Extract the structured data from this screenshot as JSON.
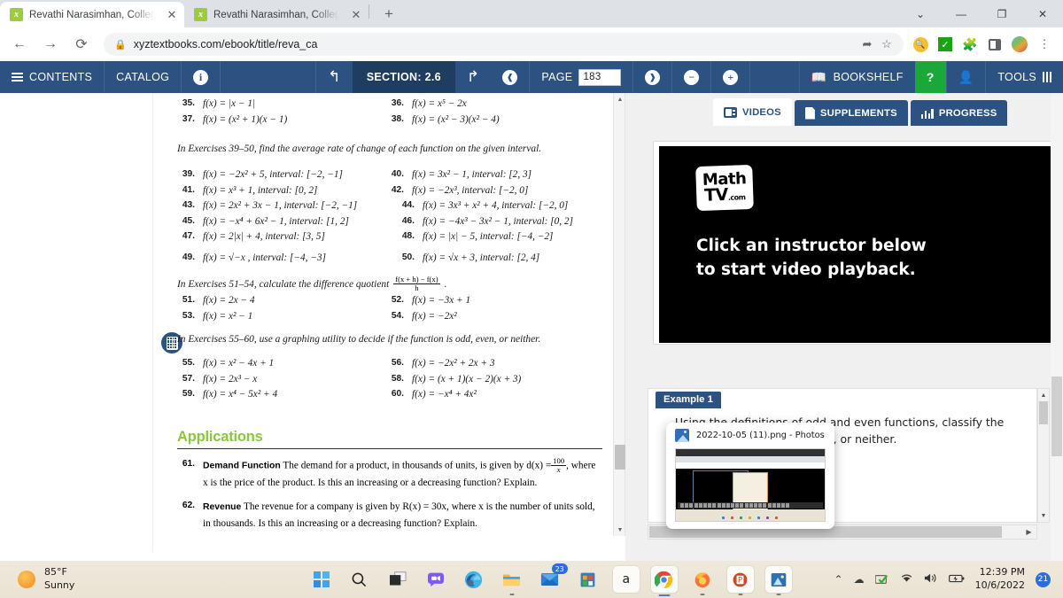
{
  "browser": {
    "tabs": [
      {
        "title": "Revathi Narasimhan, College Algebra",
        "favicon": "x",
        "active": true
      },
      {
        "title": "Revathi Narasimhan, College Algebra",
        "favicon": "x",
        "active": false
      }
    ],
    "new_tab_label": "+",
    "window_controls": {
      "minimize_to_tray": "⌄",
      "minimize": "—",
      "restore": "❐",
      "close": "✕"
    },
    "nav": {
      "back": "←",
      "forward": "→",
      "reload": "⟳"
    },
    "omnibox": {
      "lock": "🔒",
      "url": "xyztextbooks.com/ebook/title/reva_ca",
      "share": "⇪",
      "bookmark": "☆"
    },
    "extensions": [
      "search-ext",
      "checkmark-ext",
      "puzzle-ext",
      "side-panel",
      "profile-avatar",
      "chrome-menu"
    ]
  },
  "ebook_toolbar": {
    "contents": "CONTENTS",
    "catalog": "CATALOG",
    "info": "i",
    "undo": "↰",
    "section_label": "SECTION: 2.6",
    "redo": "↱",
    "prev_page": "❰",
    "page_label": "PAGE",
    "page_value": "183",
    "next_page": "❱",
    "zoom_out": "−",
    "zoom_in": "+",
    "bookshelf": "BOOKSHELF",
    "help": "?",
    "account": "account",
    "tools": "TOOLS",
    "accent_bg": "#2c5282",
    "section_bg": "#1f3d61",
    "help_bg": "#1aa83a"
  },
  "book": {
    "exercise_rows_top": [
      [
        {
          "num": "35.",
          "body": "f(x) = |x − 1|"
        },
        {
          "num": "36.",
          "body": "f(x) = x⁵ − 2x"
        }
      ],
      [
        {
          "num": "37.",
          "body": "f(x) = (x² + 1)(x − 1)"
        },
        {
          "num": "38.",
          "body": "f(x) = (x² − 3)(x² − 4)"
        }
      ]
    ],
    "direction_39_50": "In Exercises 39–50, find the average rate of change of each function on the given interval.",
    "exercise_rows_39_50": [
      [
        {
          "num": "39.",
          "body": "f(x) = −2x² + 5, interval: [−2, −1]"
        },
        {
          "num": "40.",
          "body": "f(x) = 3x² − 1, interval: [2, 3]"
        }
      ],
      [
        {
          "num": "41.",
          "body": "f(x) = x³ + 1, interval: [0, 2]"
        },
        {
          "num": "42.",
          "body": "f(x) = −2x³, interval: [−2, 0]"
        }
      ],
      [
        {
          "num": "43.",
          "body": "f(x) = 2x² + 3x − 1, interval: [−2, −1]"
        },
        {
          "num": "44.",
          "body": "f(x) = 3x³ + x² + 4, interval: [−2, 0]"
        }
      ],
      [
        {
          "num": "45.",
          "body": "f(x) = −x⁴ + 6x² − 1, interval: [1, 2]"
        },
        {
          "num": "46.",
          "body": "f(x) = −4x³ − 3x² − 1, interval: [0, 2]"
        }
      ],
      [
        {
          "num": "47.",
          "body": "f(x) = 2|x| + 4, interval: [3, 5]"
        },
        {
          "num": "48.",
          "body": "f(x) = |x| − 5, interval: [−4, −2]"
        }
      ],
      [
        {
          "num": "49.",
          "body": "f(x) = √−x , interval: [−4, −3]"
        },
        {
          "num": "50.",
          "body": "f(x) = √x + 3, interval: [2, 4]"
        }
      ]
    ],
    "direction_51_54_pre": "In Exercises 51–54, calculate the difference quotient",
    "difference_quotient_num": "f(x + h) − f(x)",
    "difference_quotient_den": "h",
    "exercise_rows_51_54": [
      [
        {
          "num": "51.",
          "body": "f(x) = 2x − 4"
        },
        {
          "num": "52.",
          "body": "f(x) = −3x + 1"
        }
      ],
      [
        {
          "num": "53.",
          "body": "f(x) = x² − 1"
        },
        {
          "num": "54.",
          "body": "f(x) = −2x²"
        }
      ]
    ],
    "direction_55_60": "In Exercises 55–60, use a graphing utility to decide if the function is odd, even, or neither.",
    "exercise_rows_55_60": [
      [
        {
          "num": "55.",
          "body": "f(x) = x² − 4x + 1"
        },
        {
          "num": "56.",
          "body": "f(x) = −2x² + 2x + 3"
        }
      ],
      [
        {
          "num": "57.",
          "body": "f(x) = 2x³ − x"
        },
        {
          "num": "58.",
          "body": "f(x) = (x + 1)(x − 2)(x + 3)"
        }
      ],
      [
        {
          "num": "59.",
          "body": "f(x) = x⁴ − 5x² + 4"
        },
        {
          "num": "60.",
          "body": "f(x) = −x⁴ + 4x²"
        }
      ]
    ],
    "applications_heading": "Applications",
    "app_61_num": "61.",
    "app_61_label": "Demand Function",
    "app_61_text_a": "The demand for a product, in thousands of units, is given by d(x) =",
    "app_61_frac_num": "100",
    "app_61_frac_den": "x",
    "app_61_text_b": ", where x is the price of the product. Is this an increasing or a decreasing function? Explain.",
    "app_62_num": "62.",
    "app_62_label": "Revenue",
    "app_62_text": "The revenue for a company is given by R(x) = 30x, where x is the number of units",
    "app_62_text_cut": "sold, in thousands. Is this an increasing or a decreasing function? Explain."
  },
  "right_panel": {
    "tabs": [
      {
        "label": "VIDEOS",
        "icon": "tv-icon",
        "active": true
      },
      {
        "label": "SUPPLEMENTS",
        "icon": "document-icon",
        "active": false
      },
      {
        "label": "PROGRESS",
        "icon": "bar-chart-icon",
        "active": false
      }
    ],
    "video": {
      "logo_line1": "Math",
      "logo_line2": "TV",
      "logo_suffix": ".com",
      "cta_line1": "Click an instructor below",
      "cta_line2": "to start video playback."
    },
    "example": {
      "badge": "Example 1",
      "text": "Using the definitions of odd and even functions, classify the given functions as odd, even, or neither."
    }
  },
  "photo_popup": {
    "title": "2022-10-05 (11).png - Photos"
  },
  "taskbar": {
    "weather_temp": "85°F",
    "weather_cond": "Sunny",
    "apps": [
      {
        "name": "start-button"
      },
      {
        "name": "search-button"
      },
      {
        "name": "task-view-button"
      },
      {
        "name": "teams-chat-button"
      },
      {
        "name": "microsoft-edge-button"
      },
      {
        "name": "file-explorer-button"
      },
      {
        "name": "mail-button",
        "badge": "23"
      },
      {
        "name": "microsoft-store-button"
      },
      {
        "name": "amazon-button"
      },
      {
        "name": "google-chrome-button"
      },
      {
        "name": "firefox-button"
      },
      {
        "name": "powerpoint-button"
      },
      {
        "name": "photos-button"
      }
    ],
    "tray": {
      "overflow": "⌃",
      "onedrive": "☁",
      "defender": "✓",
      "wifi": "wifi",
      "volume": "🔊",
      "battery": "battery"
    },
    "time": "12:39 PM",
    "date": "10/6/2022",
    "notification_count": "21"
  }
}
